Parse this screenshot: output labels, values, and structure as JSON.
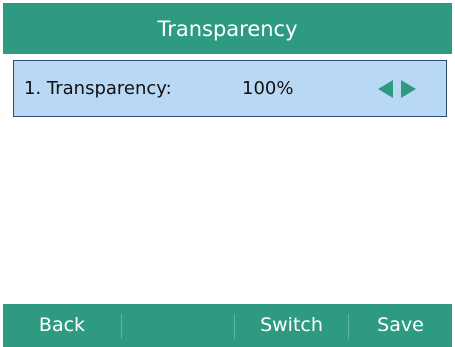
{
  "title": "Transparency",
  "row": {
    "label": "1. Transparency:",
    "value": "100%"
  },
  "icons": {
    "left_arrow": "arrow-left-icon",
    "right_arrow": "arrow-right-icon"
  },
  "softkeys": {
    "back": "Back",
    "empty": "",
    "switch": "Switch",
    "save": "Save"
  },
  "colors": {
    "header_footer": "#2e9a82",
    "selected_row": "#b9d8f3",
    "selected_border": "#2b4f72",
    "arrow": "#2e9a82"
  }
}
